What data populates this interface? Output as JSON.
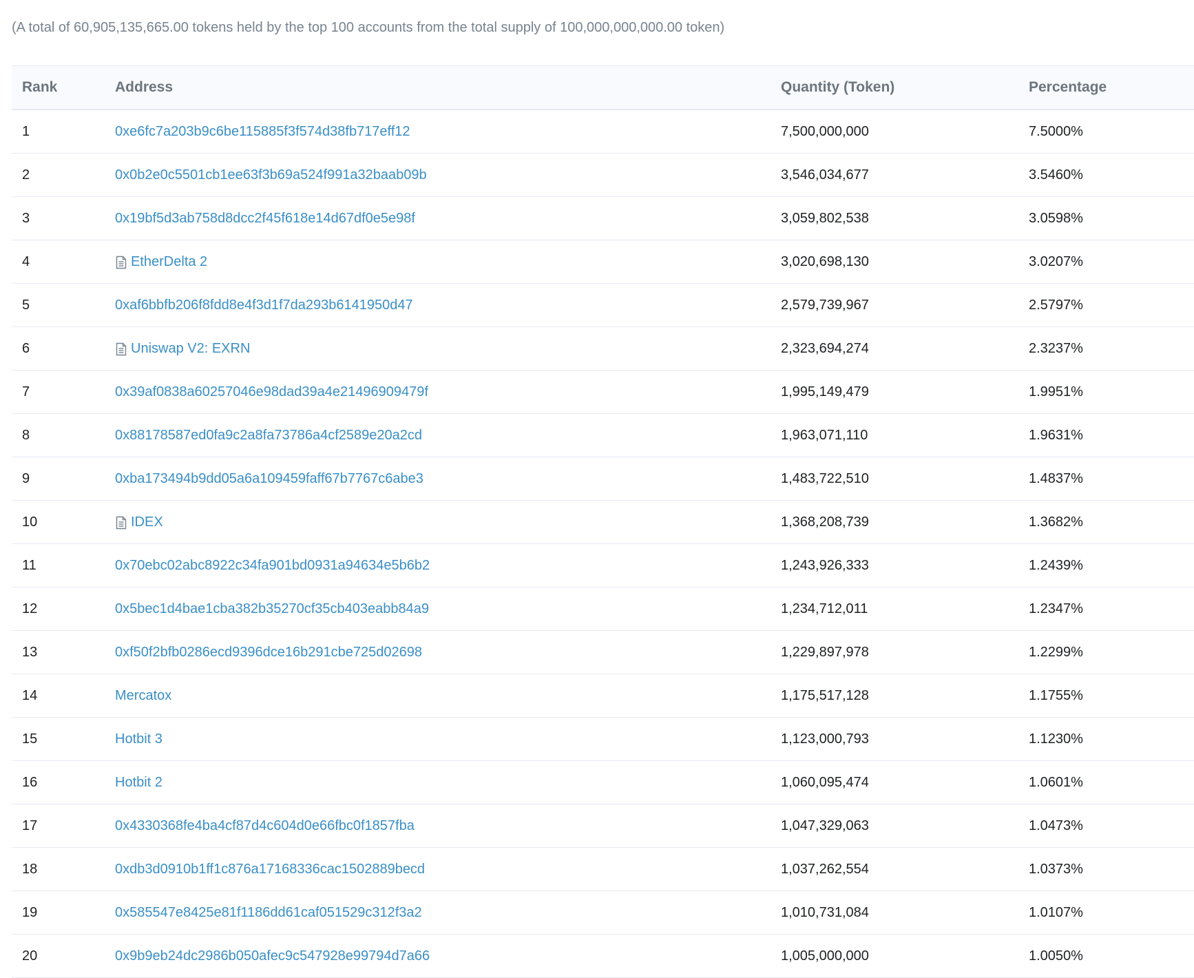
{
  "summary": "(A total of 60,905,135,665.00 tokens held by the top 100 accounts from the total supply of 100,000,000,000.00 token)",
  "headers": {
    "rank": "Rank",
    "address": "Address",
    "quantity": "Quantity (Token)",
    "percentage": "Percentage"
  },
  "rows": [
    {
      "rank": "1",
      "address": "0xe6fc7a203b9c6be115885f3f574d38fb717eff12",
      "contract": false,
      "quantity": "7,500,000,000",
      "percentage": "7.5000%"
    },
    {
      "rank": "2",
      "address": "0x0b2e0c5501cb1ee63f3b69a524f991a32baab09b",
      "contract": false,
      "quantity": "3,546,034,677",
      "percentage": "3.5460%"
    },
    {
      "rank": "3",
      "address": "0x19bf5d3ab758d8dcc2f45f618e14d67df0e5e98f",
      "contract": false,
      "quantity": "3,059,802,538",
      "percentage": "3.0598%"
    },
    {
      "rank": "4",
      "address": "EtherDelta 2",
      "contract": true,
      "quantity": "3,020,698,130",
      "percentage": "3.0207%"
    },
    {
      "rank": "5",
      "address": "0xaf6bbfb206f8fdd8e4f3d1f7da293b6141950d47",
      "contract": false,
      "quantity": "2,579,739,967",
      "percentage": "2.5797%"
    },
    {
      "rank": "6",
      "address": "Uniswap V2: EXRN",
      "contract": true,
      "quantity": "2,323,694,274",
      "percentage": "2.3237%"
    },
    {
      "rank": "7",
      "address": "0x39af0838a60257046e98dad39a4e21496909479f",
      "contract": false,
      "quantity": "1,995,149,479",
      "percentage": "1.9951%"
    },
    {
      "rank": "8",
      "address": "0x88178587ed0fa9c2a8fa73786a4cf2589e20a2cd",
      "contract": false,
      "quantity": "1,963,071,110",
      "percentage": "1.9631%"
    },
    {
      "rank": "9",
      "address": "0xba173494b9dd05a6a109459faff67b7767c6abe3",
      "contract": false,
      "quantity": "1,483,722,510",
      "percentage": "1.4837%"
    },
    {
      "rank": "10",
      "address": "IDEX",
      "contract": true,
      "quantity": "1,368,208,739",
      "percentage": "1.3682%"
    },
    {
      "rank": "11",
      "address": "0x70ebc02abc8922c34fa901bd0931a94634e5b6b2",
      "contract": false,
      "quantity": "1,243,926,333",
      "percentage": "1.2439%"
    },
    {
      "rank": "12",
      "address": "0x5bec1d4bae1cba382b35270cf35cb403eabb84a9",
      "contract": false,
      "quantity": "1,234,712,011",
      "percentage": "1.2347%"
    },
    {
      "rank": "13",
      "address": "0xf50f2bfb0286ecd9396dce16b291cbe725d02698",
      "contract": false,
      "quantity": "1,229,897,978",
      "percentage": "1.2299%"
    },
    {
      "rank": "14",
      "address": "Mercatox",
      "contract": false,
      "quantity": "1,175,517,128",
      "percentage": "1.1755%"
    },
    {
      "rank": "15",
      "address": "Hotbit 3",
      "contract": false,
      "quantity": "1,123,000,793",
      "percentage": "1.1230%"
    },
    {
      "rank": "16",
      "address": "Hotbit 2",
      "contract": false,
      "quantity": "1,060,095,474",
      "percentage": "1.0601%"
    },
    {
      "rank": "17",
      "address": "0x4330368fe4ba4cf87d4c604d0e66fbc0f1857fba",
      "contract": false,
      "quantity": "1,047,329,063",
      "percentage": "1.0473%"
    },
    {
      "rank": "18",
      "address": "0xdb3d0910b1ff1c876a17168336cac1502889becd",
      "contract": false,
      "quantity": "1,037,262,554",
      "percentage": "1.0373%"
    },
    {
      "rank": "19",
      "address": "0x585547e8425e81f1186dd61caf051529c312f3a2",
      "contract": false,
      "quantity": "1,010,731,084",
      "percentage": "1.0107%"
    },
    {
      "rank": "20",
      "address": "0x9b9eb24dc2986b050afec9c547928e99794d7a66",
      "contract": false,
      "quantity": "1,005,000,000",
      "percentage": "1.0050%"
    }
  ],
  "colors": {
    "link": "#3a8fc7",
    "text": "#1e2022",
    "muted": "#77838f",
    "border": "#e7eaf3",
    "header_bg": "#f8fafd"
  },
  "icons": {
    "contract": "file-text-icon"
  }
}
